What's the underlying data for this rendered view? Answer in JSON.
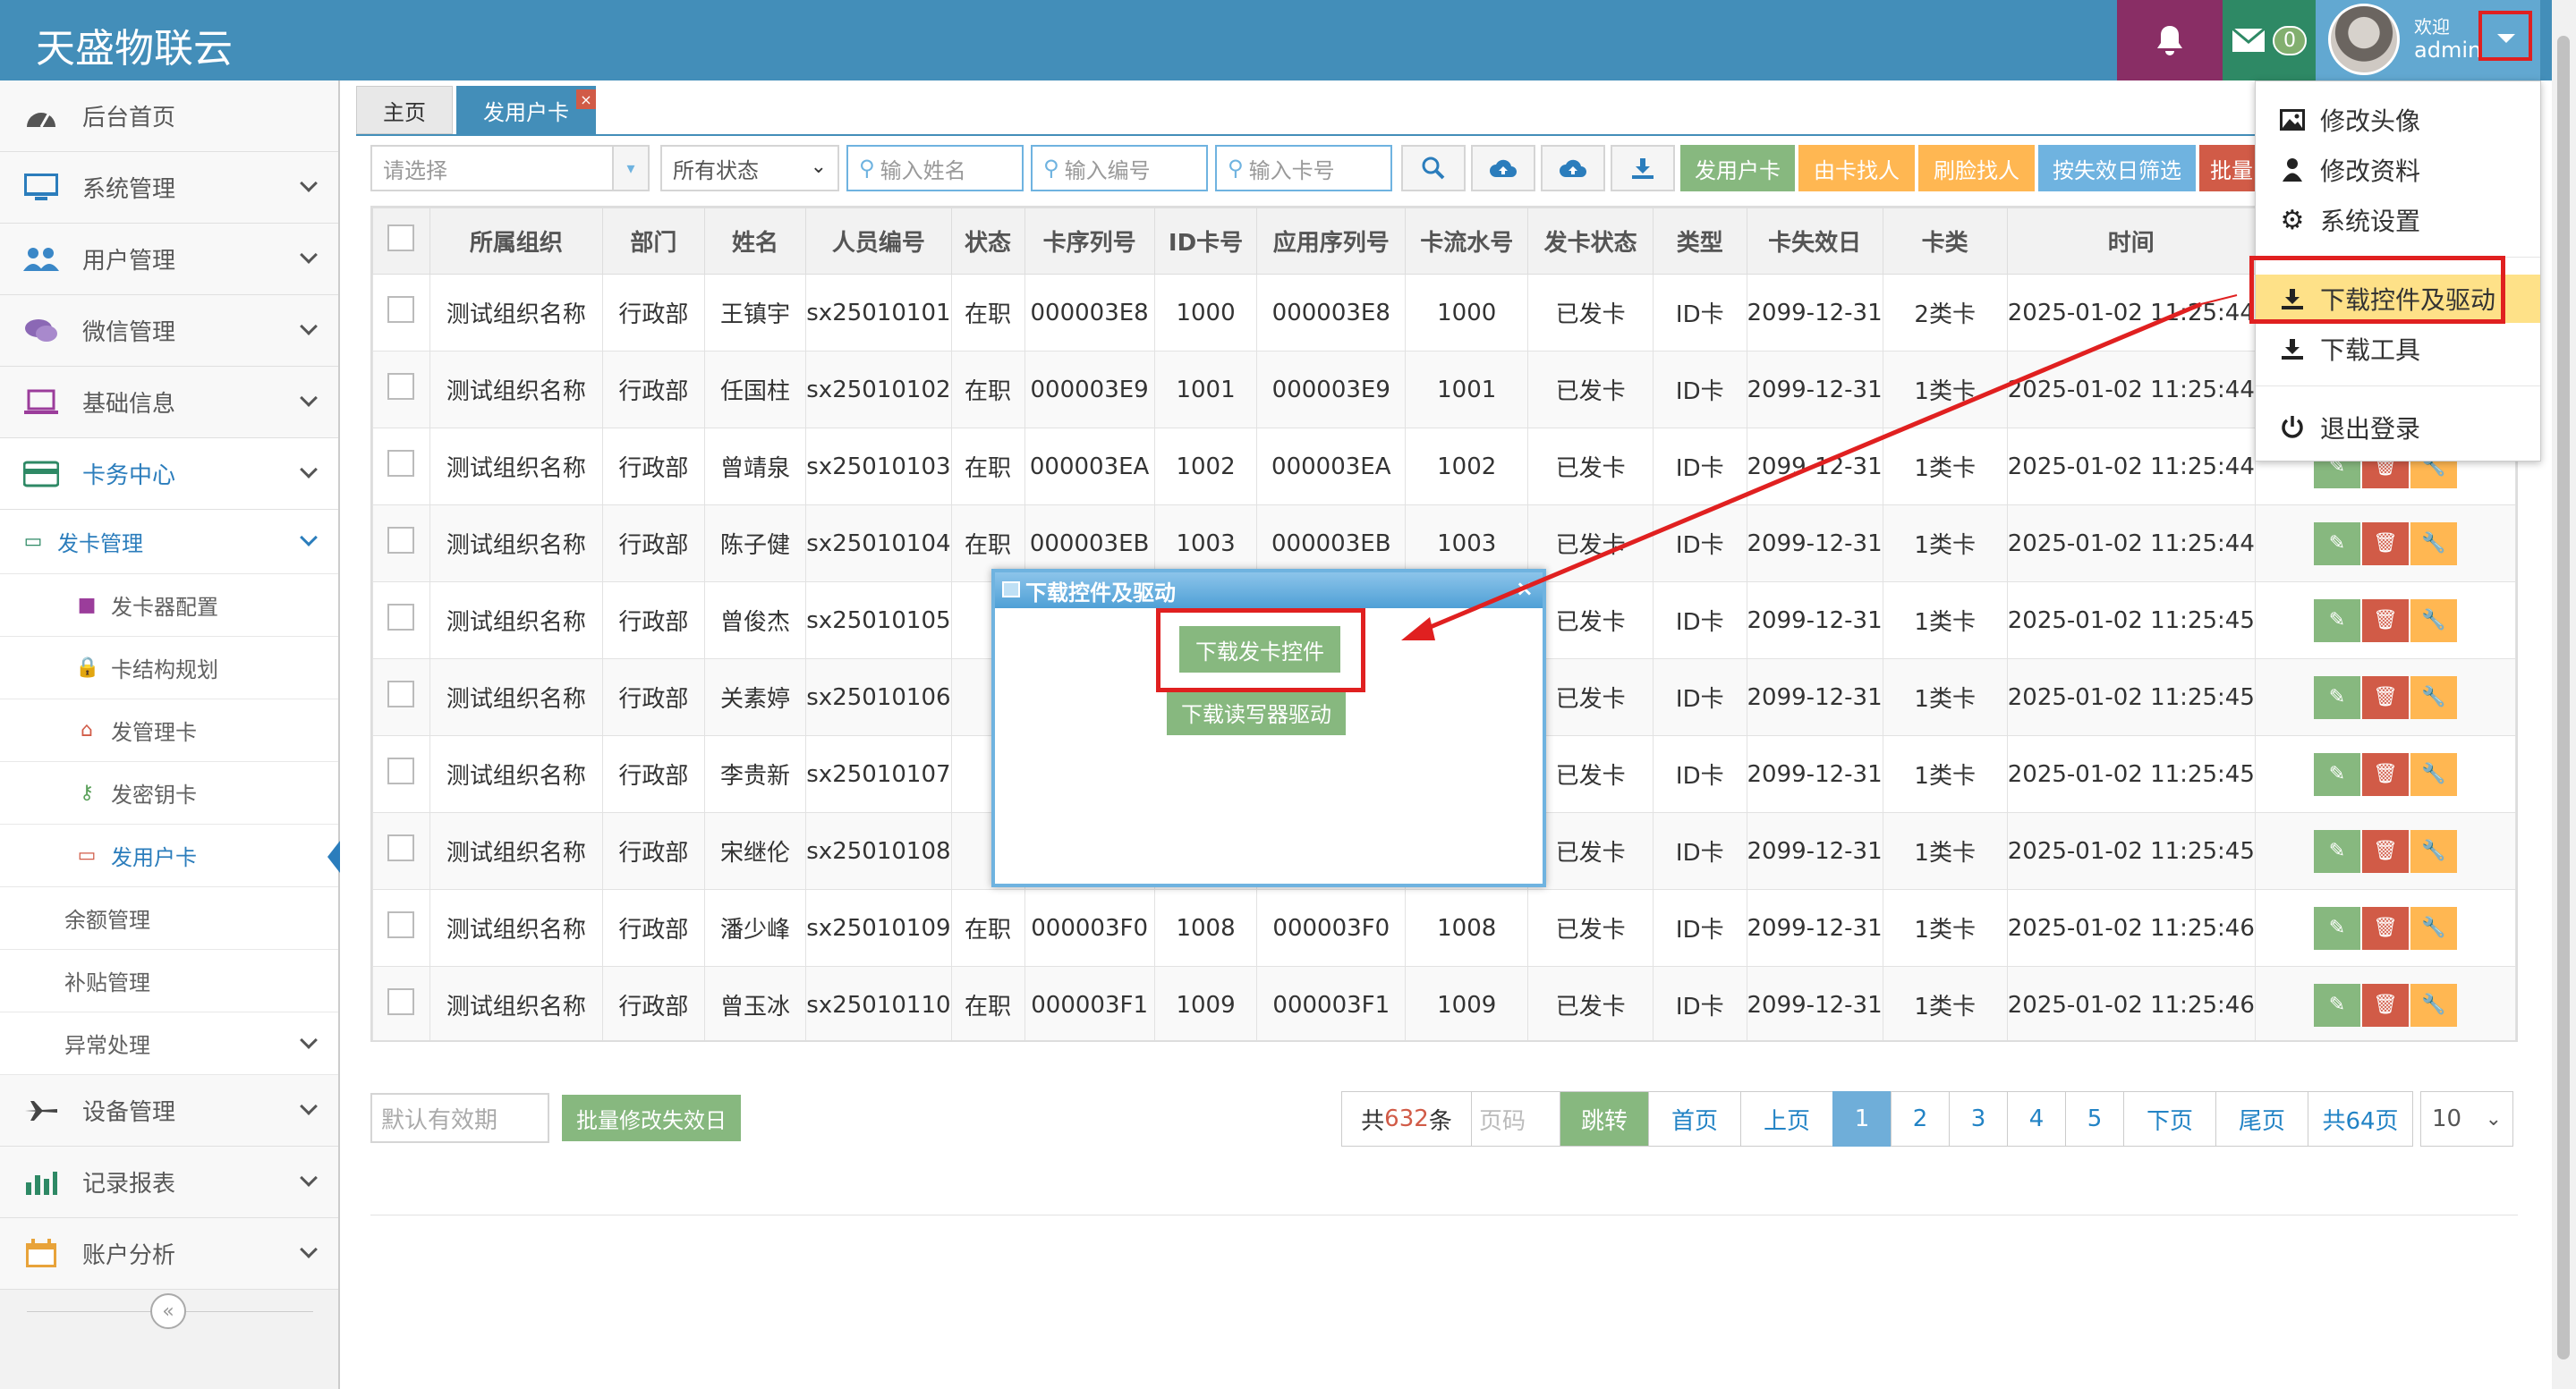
{
  "header": {
    "brand": "天盛物联云",
    "notification_count": "0",
    "welcome": "欢迎",
    "username": "admin"
  },
  "sidebar": {
    "items": [
      {
        "label": "后台首页",
        "icon": "dashboard-icon"
      },
      {
        "label": "系统管理",
        "icon": "desktop-icon"
      },
      {
        "label": "用户管理",
        "icon": "users-icon"
      },
      {
        "label": "微信管理",
        "icon": "comments-icon"
      },
      {
        "label": "基础信息",
        "icon": "laptop-icon"
      },
      {
        "label": "卡务中心",
        "icon": "credit-card-icon"
      }
    ],
    "card_center_sub": {
      "issue_mgmt": "发卡管理",
      "issue_children": [
        "发卡器配置",
        "卡结构规划",
        "发管理卡",
        "发密钥卡",
        "发用户卡"
      ],
      "balance_mgmt": "余额管理",
      "subsidy_mgmt": "补贴管理",
      "exception_mgmt": "异常处理"
    },
    "bottom_items": [
      {
        "label": "设备管理",
        "icon": "plane-icon"
      },
      {
        "label": "记录报表",
        "icon": "bar-chart-icon"
      },
      {
        "label": "账户分析",
        "icon": "calendar-icon"
      }
    ]
  },
  "tabs": {
    "home": "主页",
    "current": "发用户卡",
    "close": "×"
  },
  "toolbar": {
    "org_select_placeholder": "请选择",
    "status_select": "所有状态",
    "name_placeholder": "输入姓名",
    "number_placeholder": "输入编号",
    "card_placeholder": "输入卡号",
    "buttons": {
      "issue_user_card": "发用户卡",
      "find_by_card": "由卡找人",
      "swipe_find": "刷脸找人",
      "filter_by_expiry": "按失效日筛选",
      "batch": "批量"
    }
  },
  "table": {
    "headers": [
      "所属组织",
      "部门",
      "姓名",
      "人员编号",
      "状态",
      "卡序列号",
      "ID卡号",
      "应用序列号",
      "卡流水号",
      "发卡状态",
      "类型",
      "卡失效日",
      "卡类",
      "时间"
    ],
    "rows": [
      [
        "测试组织名称",
        "行政部",
        "王镇宇",
        "sx25010101",
        "在职",
        "000003E8",
        "1000",
        "000003E8",
        "1000",
        "已发卡",
        "ID卡",
        "2099-12-31",
        "2类卡",
        "2025-01-02 11:25:44"
      ],
      [
        "测试组织名称",
        "行政部",
        "任国柱",
        "sx25010102",
        "在职",
        "000003E9",
        "1001",
        "000003E9",
        "1001",
        "已发卡",
        "ID卡",
        "2099-12-31",
        "1类卡",
        "2025-01-02 11:25:44"
      ],
      [
        "测试组织名称",
        "行政部",
        "曾靖泉",
        "sx25010103",
        "在职",
        "000003EA",
        "1002",
        "000003EA",
        "1002",
        "已发卡",
        "ID卡",
        "2099-12-31",
        "1类卡",
        "2025-01-02 11:25:44"
      ],
      [
        "测试组织名称",
        "行政部",
        "陈子健",
        "sx25010104",
        "在职",
        "000003EB",
        "1003",
        "000003EB",
        "1003",
        "已发卡",
        "ID卡",
        "2099-12-31",
        "1类卡",
        "2025-01-02 11:25:44"
      ],
      [
        "测试组织名称",
        "行政部",
        "曾俊杰",
        "sx25010105",
        "",
        "",
        "",
        "",
        "",
        "已发卡",
        "ID卡",
        "2099-12-31",
        "1类卡",
        "2025-01-02 11:25:45"
      ],
      [
        "测试组织名称",
        "行政部",
        "关素婷",
        "sx25010106",
        "",
        "",
        "",
        "",
        "",
        "已发卡",
        "ID卡",
        "2099-12-31",
        "1类卡",
        "2025-01-02 11:25:45"
      ],
      [
        "测试组织名称",
        "行政部",
        "李贵新",
        "sx25010107",
        "",
        "",
        "",
        "",
        "",
        "已发卡",
        "ID卡",
        "2099-12-31",
        "1类卡",
        "2025-01-02 11:25:45"
      ],
      [
        "测试组织名称",
        "行政部",
        "宋继伦",
        "sx25010108",
        "",
        "",
        "",
        "",
        "",
        "已发卡",
        "ID卡",
        "2099-12-31",
        "1类卡",
        "2025-01-02 11:25:45"
      ],
      [
        "测试组织名称",
        "行政部",
        "潘少峰",
        "sx25010109",
        "在职",
        "000003F0",
        "1008",
        "000003F0",
        "1008",
        "已发卡",
        "ID卡",
        "2099-12-31",
        "1类卡",
        "2025-01-02 11:25:46"
      ],
      [
        "测试组织名称",
        "行政部",
        "曾玉冰",
        "sx25010110",
        "在职",
        "000003F1",
        "1009",
        "000003F1",
        "1009",
        "已发卡",
        "ID卡",
        "2099-12-31",
        "1类卡",
        "2025-01-02 11:25:46"
      ]
    ]
  },
  "footer": {
    "expiry_placeholder": "默认有效期",
    "batch_expiry_button": "批量修改失效日",
    "pagination": {
      "total_prefix": "共",
      "total_count": "632",
      "total_suffix": "条",
      "page_placeholder": "页码",
      "jump": "跳转",
      "first": "首页",
      "prev": "上页",
      "pages": [
        "1",
        "2",
        "3",
        "4",
        "5"
      ],
      "next": "下页",
      "last": "尾页",
      "total_pages": "共64页",
      "page_size": "10"
    }
  },
  "dialog": {
    "title": "下载控件及驱动",
    "close": "×",
    "download_control": "下载发卡控件",
    "download_driver": "下载读写器驱动"
  },
  "user_menu": {
    "change_avatar": "修改头像",
    "edit_profile": "修改资料",
    "settings": "系统设置",
    "download_controls": "下载控件及驱动",
    "download_tools": "下载工具",
    "logout": "退出登录"
  },
  "colors": {
    "navbar": "#438eb9",
    "green_button": "#87b87f",
    "orange_button": "#ffb752",
    "red_button": "#d15b47",
    "annotation": "#e02020"
  }
}
